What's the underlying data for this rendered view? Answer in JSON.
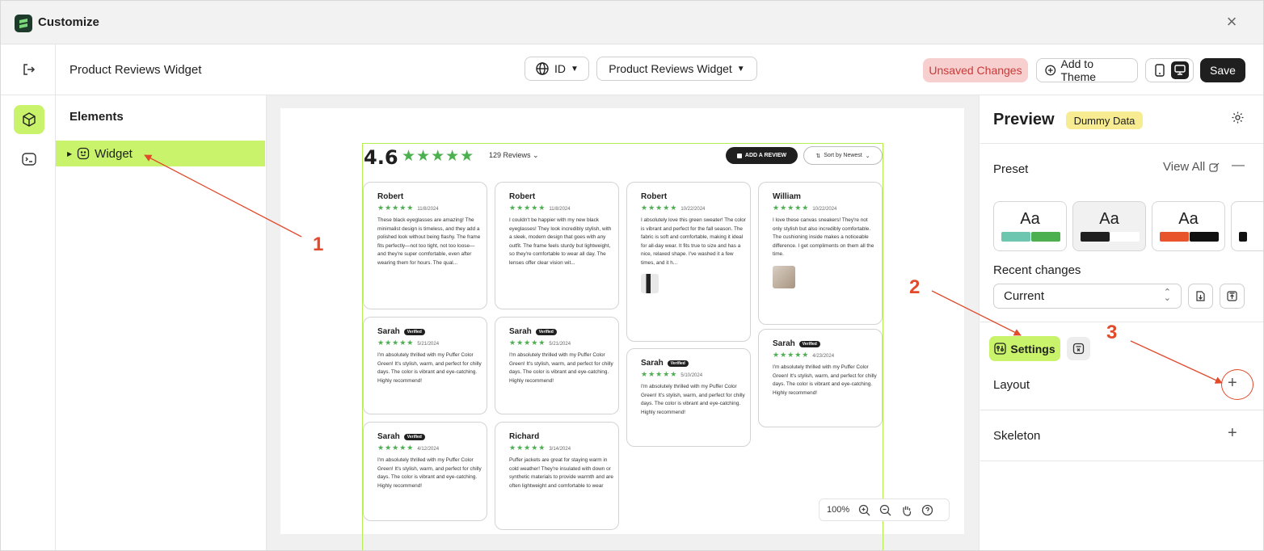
{
  "window": {
    "title": "Customize",
    "close_icon": "×"
  },
  "topbar": {
    "widget_title": "Product Reviews Widget",
    "language": "ID",
    "widget_select": "Product Reviews Widget",
    "unsaved": "Unsaved Changes",
    "add_to_theme": "Add to Theme",
    "save": "Save"
  },
  "elements": {
    "heading": "Elements",
    "tree_item": "Widget"
  },
  "preview_widget": {
    "rating": "4.6",
    "stars": "★★★★★",
    "review_count": "129 Reviews",
    "add_review": "ADD A REVIEW",
    "sort": "Sort by Newest",
    "verified": "Verified",
    "reviews": [
      {
        "name": "Robert",
        "date": "11/8/2024",
        "text": "These black eyeglasses are amazing! The minimalist design is timeless, and they add a polished look without being flashy. The frame fits perfectly—not too tight, not too loose—and they're super comfortable, even after wearing them for hours. The qual..."
      },
      {
        "name": "Robert",
        "date": "11/8/2024",
        "text": "I couldn't be happier with my new black eyeglasses! They look incredibly stylish, with a sleek, modern design that goes with any outfit. The frame feels sturdy but lightweight, so they're comfortable to wear all day. The lenses offer clear vision wit..."
      },
      {
        "name": "Robert",
        "date": "10/22/2024",
        "text": "I absolutely love this green sweater! The color is vibrant and perfect for the fall season. The fabric is soft and comfortable, making it ideal for all-day wear. It fits true to size and has a nice, relaxed shape. I've washed it a few times, and it h..."
      },
      {
        "name": "William",
        "date": "10/22/2024",
        "text": "I love these canvas sneakers! They're not only stylish but also incredibly comfortable. The cushioning inside makes a noticeable difference. I get compliments on them all the time."
      },
      {
        "name": "Sarah",
        "date": "5/21/2024",
        "text": "I'm absolutely thrilled with my Puffer Color Green! It's stylish, warm, and perfect for chilly days. The color is vibrant and eye-catching. Highly recommend!"
      },
      {
        "name": "Sarah",
        "date": "5/21/2024",
        "text": "I'm absolutely thrilled with my Puffer Color Green! It's stylish, warm, and perfect for chilly days. The color is vibrant and eye-catching. Highly recommend!"
      },
      {
        "name": "Sarah",
        "date": "5/10/2024",
        "text": "I'm absolutely thrilled with my Puffer Color Green! It's stylish, warm, and perfect for chilly days. The color is vibrant and eye-catching. Highly recommend!"
      },
      {
        "name": "Sarah",
        "date": "4/23/2024",
        "text": "I'm absolutely thrilled with my Puffer Color Green! It's stylish, warm, and perfect for chilly days. The color is vibrant and eye-catching. Highly recommend!"
      },
      {
        "name": "Sarah",
        "date": "4/12/2024",
        "text": "I'm absolutely thrilled with my Puffer Color Green! It's stylish, warm, and perfect for chilly days. The color is vibrant and eye-catching. Highly recommend!"
      },
      {
        "name": "Richard",
        "date": "3/14/2024",
        "text": "Puffer jackets are great for staying warm in cold weather! They're insulated with down or synthetic materials to provide warmth and are often lightweight and comfortable to wear"
      }
    ],
    "zoom": "100%"
  },
  "right_panel": {
    "title": "Preview",
    "badge": "Dummy Data",
    "preset_label": "Preset",
    "view_all": "View All",
    "preset_sample": "Aa",
    "recent_changes": "Recent changes",
    "current": "Current",
    "settings_tab": "Settings",
    "layout": "Layout",
    "skeleton": "Skeleton"
  },
  "annotations": {
    "n1": "1",
    "n2": "2",
    "n3": "3"
  },
  "colors": {
    "accent": "#c8f36a",
    "star": "#4caf50",
    "annotation": "#e24a2c",
    "unsaved_bg": "#f7cfcf",
    "badge_bg": "#f7ec91"
  },
  "preset_swatches": [
    [
      "#6cc6b0",
      "#4caf50"
    ],
    [
      "#1f1f1f",
      "#ffffff"
    ],
    [
      "#e8552c",
      "#111111"
    ]
  ]
}
